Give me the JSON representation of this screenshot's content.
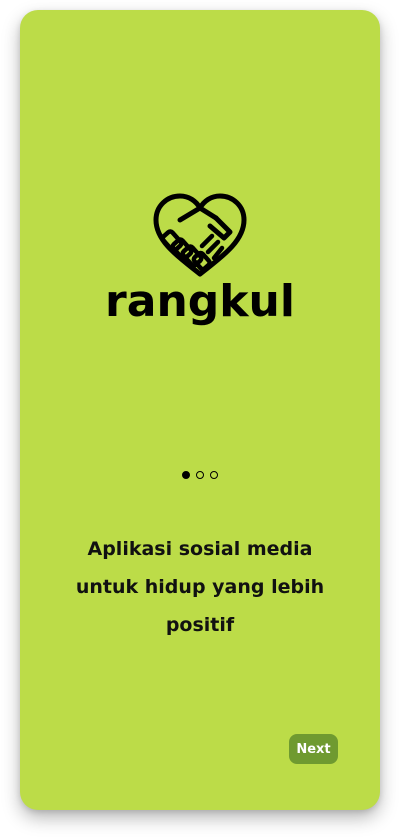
{
  "brand": {
    "name": "rangkul",
    "logo_icon": "heart-handshake-icon"
  },
  "onboarding": {
    "tagline": "Aplikasi sosial media untuk hidup yang lebih positif",
    "pages_total": 3,
    "current_page": 1
  },
  "actions": {
    "next_label": "Next"
  },
  "colors": {
    "background": "#bcdc48",
    "button": "#6f9a30",
    "text": "#000000"
  }
}
